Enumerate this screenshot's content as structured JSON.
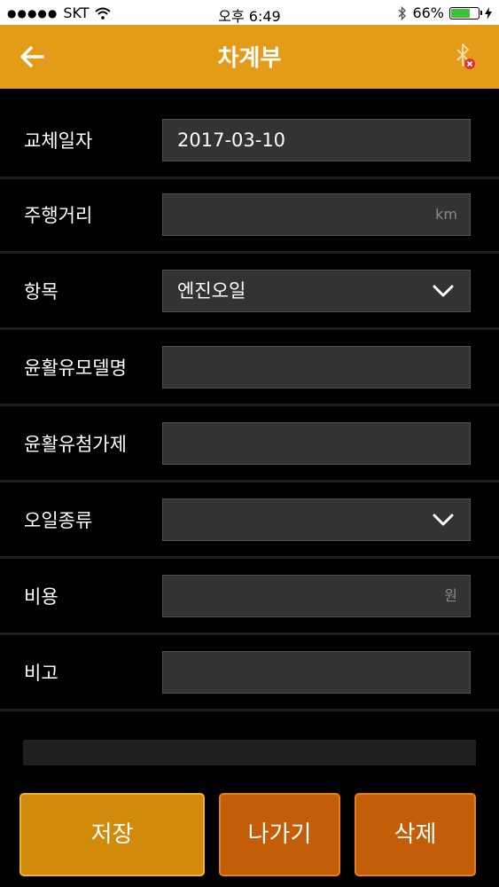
{
  "status_bar": {
    "carrier": "SKT",
    "time": "오후 6:49",
    "battery_percent": "66%",
    "battery_level": 0.66
  },
  "header": {
    "title": "차계부",
    "icons": [
      "back-arrow-icon",
      "bluetooth-disconnected-icon"
    ],
    "accent_color": "#e39b18"
  },
  "form": {
    "rows": [
      {
        "label": "교체일자",
        "value": "2017-03-10",
        "unit": "",
        "type": "text"
      },
      {
        "label": "주행거리",
        "value": "",
        "unit": "km",
        "type": "text"
      },
      {
        "label": "항목",
        "value": "엔진오일",
        "unit": "",
        "type": "select"
      },
      {
        "label": "윤활유모델명",
        "value": "",
        "unit": "",
        "type": "text"
      },
      {
        "label": "윤활유첨가제",
        "value": "",
        "unit": "",
        "type": "text"
      },
      {
        "label": "오일종류",
        "value": "",
        "unit": "",
        "type": "select"
      },
      {
        "label": "비용",
        "value": "",
        "unit": "원",
        "type": "text"
      },
      {
        "label": "비고",
        "value": "",
        "unit": "",
        "type": "text"
      }
    ]
  },
  "buttons": {
    "save": "저장",
    "exit": "나가기",
    "delete": "삭제"
  }
}
